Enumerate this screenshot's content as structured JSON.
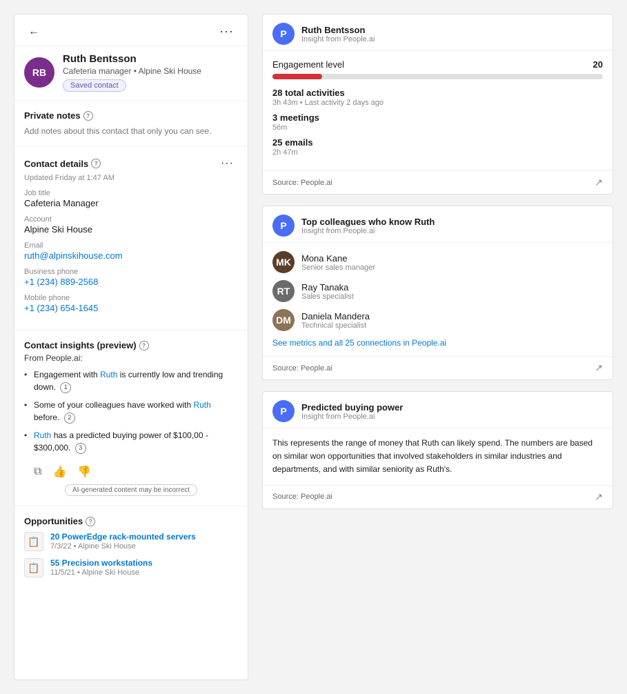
{
  "leftPanel": {
    "backButton": "←",
    "dotsButton": "···",
    "contact": {
      "initials": "RB",
      "name": "Ruth Bentsson",
      "subtitle": "Cafeteria manager • Alpine Ski House",
      "savedLabel": "Saved contact"
    },
    "privateNotes": {
      "title": "Private notes",
      "text": "Add notes about this contact that only you can see."
    },
    "contactDetails": {
      "title": "Contact details",
      "updated": "Updated Friday at 1:47 AM",
      "jobTitleLabel": "Job title",
      "jobTitleValue": "Cafeteria Manager",
      "accountLabel": "Account",
      "accountValue": "Alpine Ski House",
      "emailLabel": "Email",
      "emailValue": "ruth@alpinskihouse.com",
      "businessPhoneLabel": "Business phone",
      "businessPhoneValue": "+1 (234) 889-2568",
      "mobilePhoneLabel": "Mobile phone",
      "mobilePhoneValue": "+1 (234) 654-1645"
    },
    "insights": {
      "title": "Contact insights (preview)",
      "fromLabel": "From People.ai:",
      "items": [
        {
          "text1": "Engagement with ",
          "link": "Ruth",
          "text2": " is currently low and trending down.",
          "badge": "1"
        },
        {
          "text1": "Some of your colleagues have worked with ",
          "link": "Ruth",
          "text2": " before.",
          "badge": "2"
        },
        {
          "text1": "",
          "link": "Ruth",
          "text2": " has a predicted buying power of $100,00 - $300,000.",
          "badge": "3"
        }
      ],
      "aiDisclaimer": "AI-generated content may be incorrect"
    },
    "opportunities": {
      "title": "Opportunities",
      "items": [
        {
          "name": "20 PowerEdge rack-mounted servers",
          "sub": "7/3/22 • Alpine Ski House"
        },
        {
          "name": "55 Precision workstations",
          "sub": "11/5/21 • Alpine Ski House"
        }
      ]
    }
  },
  "rightPanel": {
    "engagementCard": {
      "personInitial": "P",
      "title": "Ruth Bentsson",
      "subtitle": "Insight from People.ai",
      "engagementLabel": "Engagement level",
      "engagementScore": "20",
      "progressPercent": 15,
      "totalActivities": "28 total activities",
      "lastActivity": "3h 43m • Last activity 2 days ago",
      "meetings": "3 meetings",
      "meetingsDuration": "56m",
      "emails": "25 emails",
      "emailsDuration": "2h 47m",
      "sourceLabel": "Source: People.ai"
    },
    "colleaguesCard": {
      "personInitial": "P",
      "title": "Top colleagues who know Ruth",
      "subtitle": "Insight from People.ai",
      "colleagues": [
        {
          "name": "Mona Kane",
          "role": "Senior sales manager",
          "initials": "MK",
          "avatarClass": "av-mona"
        },
        {
          "name": "Ray Tanaka",
          "role": "Sales specialist",
          "initials": "RT",
          "avatarClass": "av-ray"
        },
        {
          "name": "Daniela Mandera",
          "role": "Technical specialist",
          "initials": "DM",
          "avatarClass": "av-daniela"
        }
      ],
      "seeMetrics": "See metrics and all 25 connections in People.ai",
      "sourceLabel": "Source: People.ai"
    },
    "buyingPowerCard": {
      "personInitial": "P",
      "title": "Predicted buying power",
      "subtitle": "Insight from People.ai",
      "description": "This represents the range of money that Ruth can likely spend. The numbers are based on similar won opportunities that involved stakeholders in similar industries and departments, and with similar seniority as Ruth's.",
      "sourceLabel": "Source: People.ai"
    }
  }
}
